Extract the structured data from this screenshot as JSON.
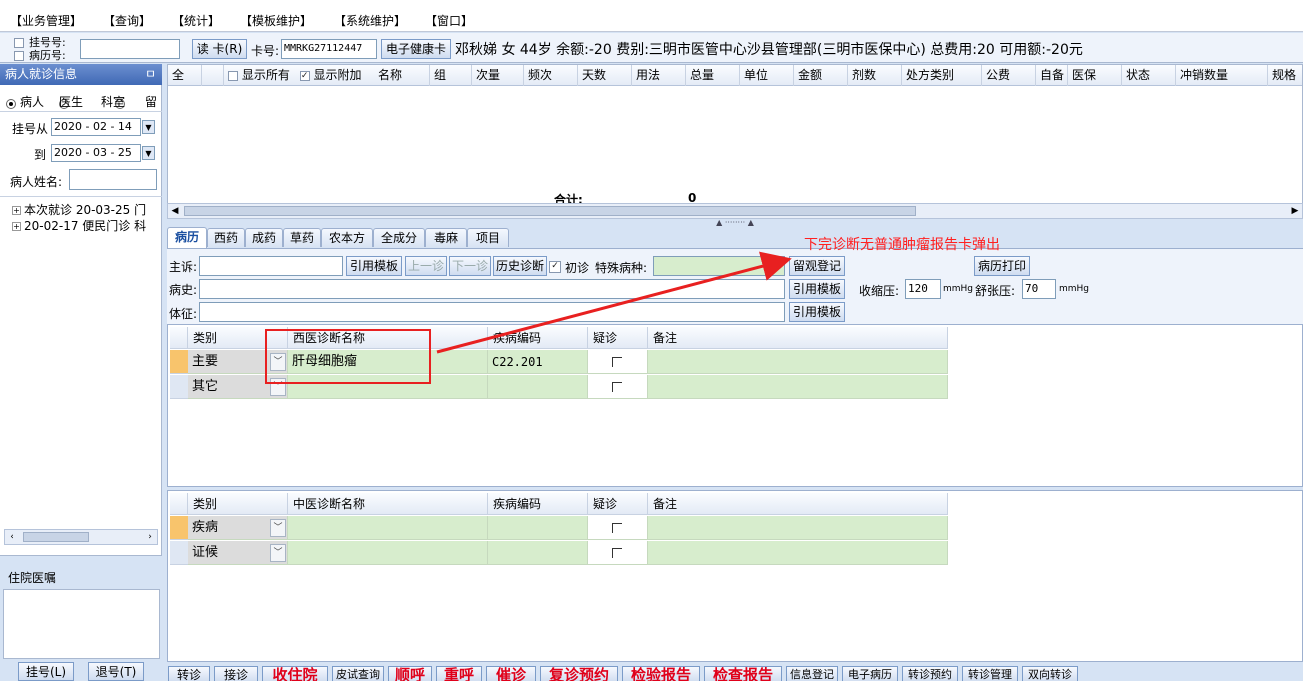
{
  "menu": [
    "【业务管理】",
    "【查询】",
    "【统计】",
    "【模板维护】",
    "【系统维护】",
    "【窗口】"
  ],
  "infobar": {
    "reg_no_label": "挂号号:",
    "record_no_label": "病历号:",
    "read_card_label": "读 卡(R)",
    "card_no_label": "卡号:",
    "card_no_value": "MMRKG27112447",
    "ehealth_button": "电子健康卡",
    "patient_summary": "邓秋娣 女 44岁 余额:-20 费别:三明市医管中心沙县管理部(三明市医保中心) 总费用:20 可用额:-20元"
  },
  "left": {
    "header": "病人就诊信息",
    "pin": "ㅁ",
    "radios": [
      "病人",
      "医生",
      "科室",
      "留"
    ],
    "date_from_label": "挂号从",
    "date_from": "2020 - 02 - 14",
    "date_to_label": "到",
    "date_to": "2020 - 03 - 25",
    "name_label": "病人姓名:",
    "visits": [
      "本次就诊 20-03-25 门",
      "20-02-17 便民门诊 科"
    ],
    "ward_label": "住院医嘱",
    "register_button": "挂号(L)",
    "unregister_button": "退号(T)"
  },
  "grid": {
    "all_label": "全",
    "show_all": "显示所有",
    "show_extra": "显示附加",
    "columns": [
      "名称",
      "组",
      "次量",
      "频次",
      "天数",
      "用法",
      "总量",
      "单位",
      "金额",
      "剂数",
      "处方类别",
      "公费",
      "自备",
      "医保",
      "状态",
      "冲销数量",
      "规格"
    ],
    "sum_label": "合计:",
    "sum_value": "0"
  },
  "tabs": [
    "病历",
    "西药",
    "成药",
    "草药",
    "农本方",
    "全成分",
    "毒麻",
    "项目"
  ],
  "form": {
    "complaint_label": "主诉:",
    "history_label": "病史:",
    "signs_label": "体征:",
    "cite_template": "引用模板",
    "prev_visit": "上一诊",
    "next_visit": "下一诊",
    "history_diag": "历史诊断",
    "first_visit": "初诊",
    "special_disease_label": "特殊病种:",
    "observe_register": "留观登记",
    "print_record": "病历打印",
    "systolic_label": "收缩压:",
    "systolic_value": "120",
    "diastolic_label": "舒张压:",
    "diastolic_value": "70",
    "unit_mmhg": "mmHg"
  },
  "western_diag": {
    "headers": [
      "类别",
      "西医诊断名称",
      "疾病编码",
      "疑诊",
      "备注"
    ],
    "rows": [
      {
        "category": "主要",
        "name": "肝母细胞瘤",
        "code": "C22.201"
      },
      {
        "category": "其它",
        "name": "",
        "code": ""
      }
    ]
  },
  "tcm_diag": {
    "headers": [
      "类别",
      "中医诊断名称",
      "疾病编码",
      "疑诊",
      "备注"
    ],
    "rows": [
      {
        "category": "疾病"
      },
      {
        "category": "证候"
      }
    ]
  },
  "bottom_buttons": [
    {
      "label": "转诊",
      "red": false
    },
    {
      "label": "接诊",
      "red": false
    },
    {
      "label": "收住院",
      "red": true
    },
    {
      "label": "皮试查询",
      "red": false
    },
    {
      "label": "顺呼",
      "red": true
    },
    {
      "label": "重呼",
      "red": true
    },
    {
      "label": "催诊",
      "red": true
    },
    {
      "label": "复诊预约",
      "red": true
    },
    {
      "label": "检验报告",
      "red": true
    },
    {
      "label": "检查报告",
      "red": true
    },
    {
      "label": "信息登记",
      "red": false
    },
    {
      "label": "电子病历",
      "red": false
    },
    {
      "label": "转诊预约",
      "red": false
    },
    {
      "label": "转诊管理",
      "red": false
    },
    {
      "label": "双向转诊",
      "red": false
    }
  ],
  "annotation": "下完诊断无普通肿瘤报告卡弹出",
  "colors": {
    "accent_red": "#e82020",
    "grid_green": "#d7edcd",
    "header_blue": "#4069b5"
  }
}
